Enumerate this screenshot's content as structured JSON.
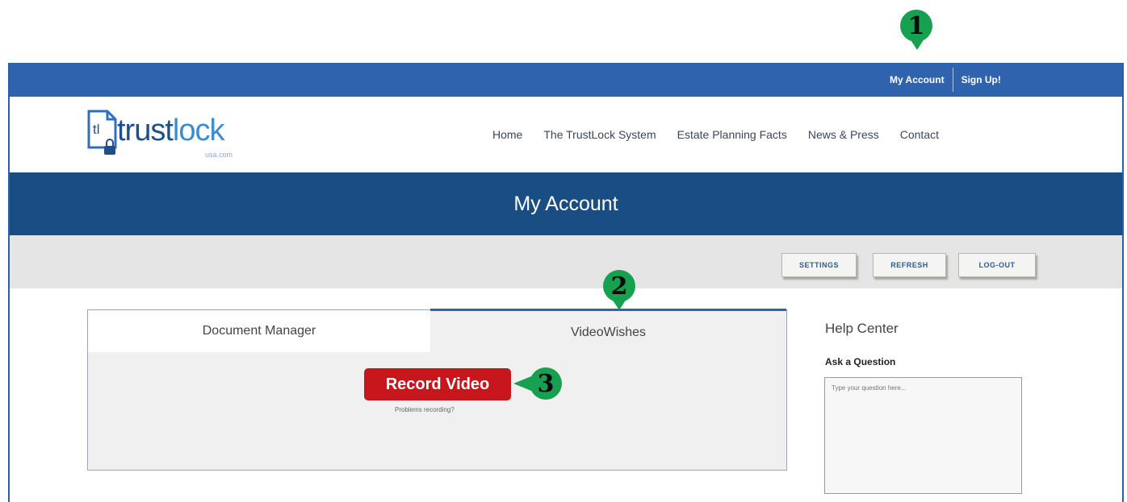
{
  "topbar": {
    "my_account": "My Account",
    "sign_up": "Sign Up!"
  },
  "logo": {
    "mark": "tl",
    "word_a": "trust",
    "word_b": "lock",
    "sub": "usa.com"
  },
  "nav": {
    "home": "Home",
    "system": "The TrustLock System",
    "facts": "Estate Planning Facts",
    "news": "News & Press",
    "contact": "Contact"
  },
  "page_title": "My Account",
  "toolbar": {
    "settings": "SETTINGS",
    "refresh": "REFRESH",
    "logout": "LOG-OUT"
  },
  "tabs": {
    "doc_manager": "Document Manager",
    "video_wishes": "VideoWishes"
  },
  "record": {
    "label": "Record Video",
    "problems": "Problems recording?"
  },
  "help": {
    "title": "Help Center",
    "ask_label": "Ask a Question",
    "placeholder": "Type your question here..."
  },
  "markers": {
    "m1": "1",
    "m2": "2",
    "m3": "3"
  },
  "colors": {
    "topbar": "#2f63ad",
    "title_bar": "#1a4d84",
    "record_button": "#c8161d",
    "marker": "#17a04f"
  }
}
